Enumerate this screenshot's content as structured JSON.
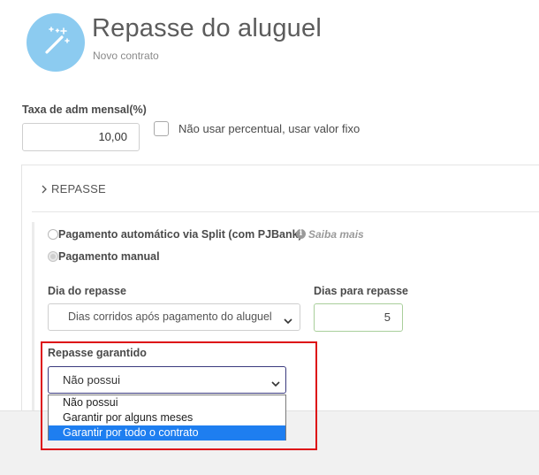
{
  "header": {
    "title": "Repasse do aluguel",
    "subtitle": "Novo contrato",
    "icon": "magic-wand-icon",
    "icon_color": "#8ccbf0"
  },
  "taxa": {
    "label": "Taxa de adm mensal(%)",
    "value": "10,00",
    "fixed_checkbox_label": "Não usar percentual, usar valor fixo",
    "fixed_checkbox_checked": false
  },
  "repasse": {
    "section_label": "REPASSE",
    "payment_options": [
      {
        "label": "Pagamento automático via Split (com PJBank)",
        "selected": false
      },
      {
        "label": "Pagamento manual",
        "selected": true
      }
    ],
    "saiba_mais": "Saiba mais",
    "dia_label": "Dia do repasse",
    "dia_value": "Dias corridos após pagamento do aluguel",
    "dias_label": "Dias para repasse",
    "dias_value": "5",
    "garantido_label": "Repasse garantido",
    "garantido_value": "Não possui",
    "garantido_options": [
      "Não possui",
      "Garantir por alguns meses",
      "Garantir por todo o contrato"
    ],
    "garantido_highlighted_option": "Garantir por todo o contrato"
  },
  "colors": {
    "highlight_border": "#dd0f15",
    "option_highlight": "#1e7ef0",
    "dias_input_border": "#a9cf9b"
  }
}
